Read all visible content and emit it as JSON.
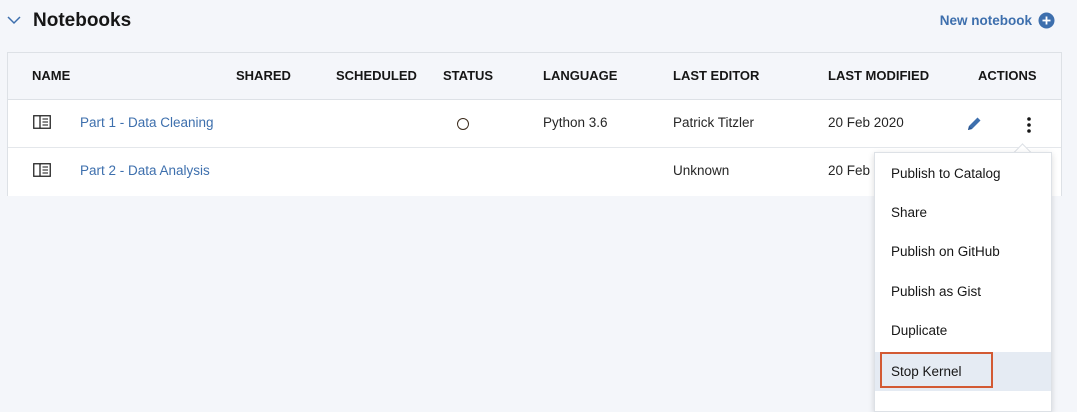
{
  "section": {
    "title": "Notebooks",
    "new_label": "New notebook"
  },
  "columns": [
    "NAME",
    "SHARED",
    "SCHEDULED",
    "STATUS",
    "LANGUAGE",
    "LAST EDITOR",
    "LAST MODIFIED",
    "ACTIONS"
  ],
  "rows": [
    {
      "name": "Part 1 - Data Cleaning",
      "shared": "",
      "scheduled": "",
      "status": "stopped",
      "language": "Python 3.6",
      "last_editor": "Patrick Titzler",
      "last_modified": "20 Feb 2020"
    },
    {
      "name": "Part 2 - Data Analysis",
      "shared": "",
      "scheduled": "",
      "status": "",
      "language": "",
      "last_editor": "Unknown",
      "last_modified": "20 Feb"
    }
  ],
  "menu": {
    "items": [
      "Publish to Catalog",
      "Share",
      "Publish on GitHub",
      "Publish as Gist",
      "Duplicate",
      "Stop Kernel"
    ],
    "hovered": "Stop Kernel"
  },
  "colors": {
    "link": "#3d6fad",
    "highlight": "#d35a33",
    "background": "#f4f6fa"
  },
  "icons": {
    "collapse": "chevron-down-icon",
    "add": "add-circle-icon",
    "notebook": "notebook-icon",
    "status": "kernel-status-icon",
    "edit": "pencil-icon",
    "overflow": "overflow-menu-icon"
  }
}
